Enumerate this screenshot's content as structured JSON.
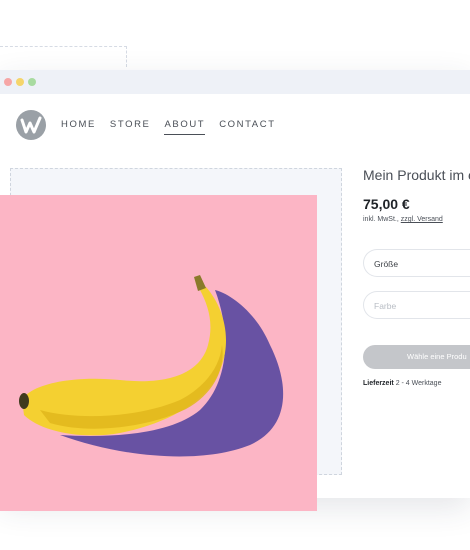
{
  "window": {
    "controls": [
      "close",
      "minimize",
      "maximize"
    ]
  },
  "header": {
    "logo_icon": "w-logo-icon",
    "nav": [
      {
        "label": "HOME",
        "active": false
      },
      {
        "label": "STORE",
        "active": false
      },
      {
        "label": "ABOUT",
        "active": true
      },
      {
        "label": "CONTACT",
        "active": false
      }
    ]
  },
  "product": {
    "title": "Mein Produkt im ei",
    "price": "75,00 €",
    "tax_note_prefix": "inkl. MwSt.,",
    "tax_note_link": "zzgl. Versand",
    "size_select": "Größe",
    "color_select_placeholder": "Farbe",
    "cta_label": "Wähle eine Produ",
    "delivery_label": "Lieferzeit",
    "delivery_value": "2 - 4 Werktage",
    "image_subject": "banana-image",
    "image_bg_color": "#fcb5c5"
  }
}
